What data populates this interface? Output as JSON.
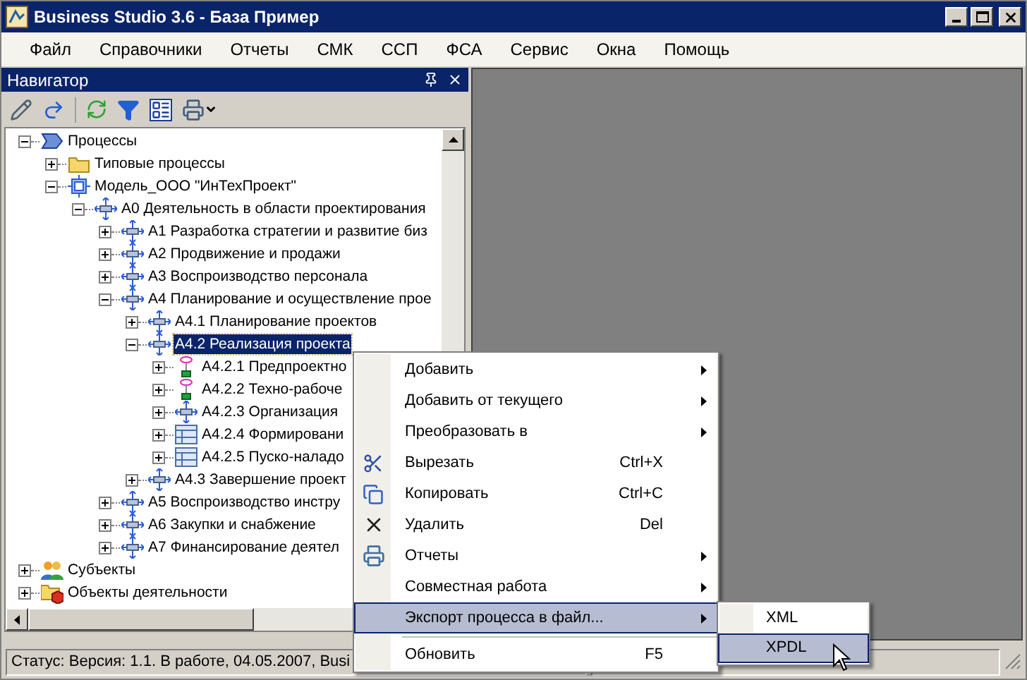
{
  "window": {
    "title": "Business Studio 3.6 - База Пример"
  },
  "menu_bar": [
    "Файл",
    "Справочники",
    "Отчеты",
    "СМК",
    "ССП",
    "ФСА",
    "Сервис",
    "Окна",
    "Помощь"
  ],
  "navigator": {
    "title": "Навигатор",
    "tree": [
      {
        "label": "Процессы",
        "kind": "process",
        "expanded": true,
        "selected": false,
        "children": [
          {
            "label": "Типовые процессы",
            "kind": "folder",
            "expanded": false,
            "selected": false
          },
          {
            "label": "Модель_ООО \"ИнТехПроект\"",
            "kind": "model",
            "expanded": true,
            "selected": false,
            "children": [
              {
                "label": "А0 Деятельность в области проектирования",
                "kind": "function",
                "expanded": true,
                "selected": false,
                "children": [
                  {
                    "label": "А1 Разработка стратегии и развитие биз",
                    "kind": "function",
                    "expanded": false,
                    "selected": false
                  },
                  {
                    "label": "А2 Продвижение и продажи",
                    "kind": "function",
                    "expanded": false,
                    "selected": false
                  },
                  {
                    "label": "А3 Воспроизводство персонала",
                    "kind": "function",
                    "expanded": false,
                    "selected": false
                  },
                  {
                    "label": "А4 Планирование и осуществление прое",
                    "kind": "function",
                    "expanded": true,
                    "selected": false,
                    "children": [
                      {
                        "label": "А4.1 Планирование проектов",
                        "kind": "function",
                        "expanded": false,
                        "selected": false
                      },
                      {
                        "label": "А4.2 Реализация проекта",
                        "kind": "function",
                        "expanded": true,
                        "selected": true,
                        "children": [
                          {
                            "label": "А4.2.1 Предпроектно",
                            "kind": "event",
                            "expanded": false,
                            "selected": false
                          },
                          {
                            "label": "А4.2.2 Техно-рабоче",
                            "kind": "event",
                            "expanded": false,
                            "selected": false
                          },
                          {
                            "label": "А4.2.3 Организация",
                            "kind": "function",
                            "expanded": false,
                            "selected": false
                          },
                          {
                            "label": "А4.2.4 Формировани",
                            "kind": "table",
                            "expanded": false,
                            "selected": false
                          },
                          {
                            "label": "А4.2.5 Пуско-наладо",
                            "kind": "table",
                            "expanded": false,
                            "selected": false
                          }
                        ]
                      },
                      {
                        "label": "А4.3 Завершение проект",
                        "kind": "function",
                        "expanded": false,
                        "selected": false
                      }
                    ]
                  },
                  {
                    "label": "А5 Воспроизводство инстру",
                    "kind": "function",
                    "expanded": false,
                    "selected": false
                  },
                  {
                    "label": "А6 Закупки и снабжение",
                    "kind": "function",
                    "expanded": false,
                    "selected": false
                  },
                  {
                    "label": "А7 Финансирование деятел",
                    "kind": "function",
                    "expanded": false,
                    "selected": false
                  }
                ]
              }
            ]
          }
        ]
      },
      {
        "label": "Субъекты",
        "kind": "subjects",
        "expanded": false,
        "selected": false
      },
      {
        "label": "Объекты деятельности",
        "kind": "objects",
        "expanded": false,
        "selected": false
      }
    ]
  },
  "status_bar": "Статус: Версия: 1.1. В работе, 04.05.2007, Busi",
  "context_menu": [
    {
      "label": "Добавить",
      "submenu": true,
      "selected": false
    },
    {
      "label": "Добавить от текущего",
      "submenu": true,
      "selected": false
    },
    {
      "label": "Преобразовать в",
      "submenu": true,
      "selected": false
    },
    {
      "label": "Вырезать",
      "kind": "cut",
      "shortcut": "Ctrl+X",
      "submenu": false,
      "selected": false
    },
    {
      "label": "Копировать",
      "kind": "copy",
      "shortcut": "Ctrl+C",
      "submenu": false,
      "selected": false
    },
    {
      "label": "Удалить",
      "kind": "delete",
      "shortcut": "Del",
      "submenu": false,
      "selected": false
    },
    {
      "label": "Отчеты",
      "kind": "print",
      "submenu": true,
      "selected": false
    },
    {
      "label": "Совместная работа",
      "submenu": true,
      "selected": false
    },
    {
      "label": "Экспорт процесса в файл...",
      "submenu": true,
      "selected": true
    },
    {
      "label": "Обновить",
      "shortcut": "F5",
      "submenu": false,
      "selected": false,
      "separator_before": true
    }
  ],
  "submenu": [
    {
      "label": "XML",
      "selected": false
    },
    {
      "label": "XPDL",
      "selected": true
    }
  ]
}
